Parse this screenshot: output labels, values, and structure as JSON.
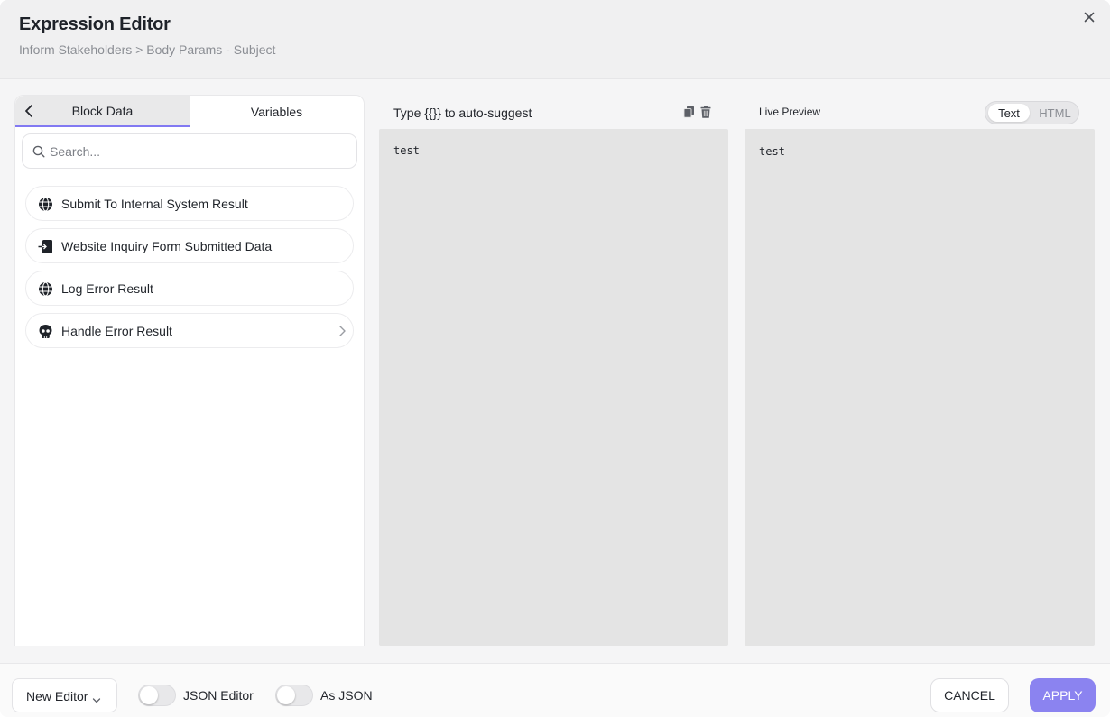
{
  "header": {
    "title": "Expression Editor",
    "breadcrumb": "Inform Stakeholders > Body Params - Subject"
  },
  "left_panel": {
    "tabs": [
      {
        "label": "Block Data",
        "active": true
      },
      {
        "label": "Variables",
        "active": false
      }
    ],
    "search": {
      "placeholder": "Search...",
      "value": ""
    },
    "items": [
      {
        "label": "Submit To Internal System Result",
        "icon": "globe-icon"
      },
      {
        "label": "Website Inquiry Form Submitted Data",
        "icon": "form-entry-icon"
      },
      {
        "label": "Log Error Result",
        "icon": "globe-icon"
      },
      {
        "label": "Handle Error Result",
        "icon": "skull-icon",
        "has_chevron": true
      }
    ]
  },
  "editor": {
    "hint": "Type {{}} to auto-suggest",
    "content": "test"
  },
  "preview": {
    "label": "Live Preview",
    "modes": [
      "Text",
      "HTML"
    ],
    "selected_mode": "Text",
    "content": "test"
  },
  "footer": {
    "editor_select": "New Editor",
    "json_editor_label": "JSON Editor",
    "json_editor_on": false,
    "as_json_label": "As JSON",
    "as_json_on": false,
    "cancel_label": "CANCEL",
    "apply_label": "APPLY"
  },
  "colors": {
    "accent": "#8279f2",
    "apply_button": "#8b83f0",
    "header_bg": "#f0f0f1",
    "editor_bg": "#e4e4e4"
  }
}
